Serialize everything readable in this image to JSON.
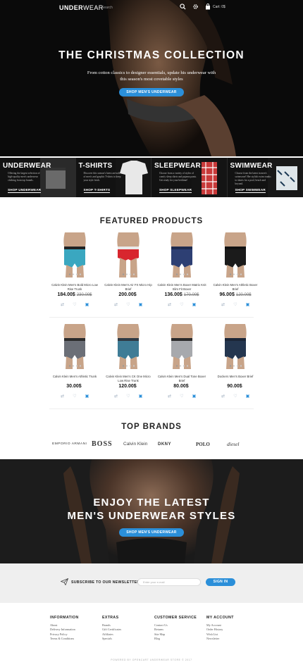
{
  "header": {
    "logo_bold": "UNDER",
    "logo_light": "WEAR",
    "search_placeholder": "Search",
    "cart_label": "Cart: 0$"
  },
  "hero": {
    "title": "THE CHRISTMAS COLLECTION",
    "subtitle": "From cotton classics to designer essentials, update his underwear with this season's most covetable styles",
    "button": "SHOP MEN'S UNDERWEAR"
  },
  "categories": [
    {
      "title": "UNDERWEAR",
      "desc": "Offering the largest selection of high-quality men's underwear clothing from top brands.",
      "link": "SHOP UNDERWEAR"
    },
    {
      "title": "T-SHIRTS",
      "desc": "Discover this season's latest arrivals of men's and graphic T-shirts to keep your style fresh.",
      "link": "SHOP T-SHIRTS"
    },
    {
      "title": "SLEEPWEAR",
      "desc": "Choose from a variety of styles of comfy sleep shirts and pajama pants. Get ready for your bedtime!",
      "link": "SHOP SLEEPWEAR"
    },
    {
      "title": "SWIMWEAR",
      "desc": "Choose from the latest in men's swimwear! Her stylish swim trunks to shorts for a pool, beach and beyond.",
      "link": "SHOP SWIMWEAR"
    }
  ],
  "featured": {
    "title": "FEATURED PRODUCTS",
    "products": [
      {
        "name": "Calvin Klein Men's Bold Micro Low Rise Trunk",
        "price": "184.00$",
        "old_price": "230.00$",
        "color": "#3aa7c0",
        "band": "#222222"
      },
      {
        "name": "Calvin Klein Men's Air FX Micro Hip Brief",
        "price": "200.00$",
        "old_price": "",
        "color": "#d8262e",
        "band": "#e9e9e9"
      },
      {
        "name": "Calvin Klein Men's Boxer Matrix Knit Slim Fit Boxer",
        "price": "136.00$",
        "old_price": "170.00$",
        "color": "#2d3f73",
        "band": "#1e2a4f"
      },
      {
        "name": "Calvin Klein Men's Athletic Boxer Brief",
        "price": "96.00$",
        "old_price": "120.00$",
        "color": "#1b1b1b",
        "band": "#111111"
      },
      {
        "name": "Calvin Klein Men's Athletic Trunk",
        "price": "30.00$",
        "old_price": "",
        "color": "#6b6f77",
        "band": "#2b2b2b"
      },
      {
        "name": "Calvin Klein Men's CK One Micro Low Rise Trunk",
        "price": "120.00$",
        "old_price": "",
        "color": "#3f7c96",
        "band": "#2f3a44"
      },
      {
        "name": "Calvin Klein Men's Dual Tone Boxer Brief",
        "price": "80.00$",
        "old_price": "",
        "color": "#a7a9ad",
        "band": "#2a2a2a"
      },
      {
        "name": "Dockers Men's Boxer Brief",
        "price": "90.00$",
        "old_price": "",
        "color": "#24364f",
        "band": "#1b2536"
      }
    ]
  },
  "brands": {
    "title": "TOP BRANDS",
    "items": [
      "EMPORIO ARMANI",
      "BOSS",
      "Calvin Klein",
      "DKNY",
      "POLO",
      "diesel"
    ]
  },
  "promo": {
    "title_line1": "ENJOY THE LATEST",
    "title_line2": "MEN'S UNDERWEAR STYLES",
    "button": "SHOP MEN'S UNDERWEAR"
  },
  "newsletter": {
    "label": "SUBSCRIBE TO OUR NEWSLETTER",
    "placeholder": "Enter your e-mail",
    "button": "SIGN IN"
  },
  "footer": {
    "columns": [
      {
        "title": "INFORMATION",
        "links": [
          "About",
          "Delivery Information",
          "Privacy Policy",
          "Terms & Conditions"
        ]
      },
      {
        "title": "EXTRAS",
        "links": [
          "Brands",
          "Gift Certificates",
          "Affiliates",
          "Specials"
        ]
      },
      {
        "title": "CUSTOMER SERVICE",
        "links": [
          "Contact Us",
          "Returns",
          "Site Map",
          "Blog"
        ]
      },
      {
        "title": "MY ACCOUNT",
        "links": [
          "My Account",
          "Order History",
          "Wish List",
          "Newsletter"
        ]
      }
    ],
    "copyright": "POWERED BY OPENCART UNDERWEAR STORE © 2017"
  },
  "colors": {
    "accent": "#2b8fd9",
    "dark": "#111111"
  }
}
